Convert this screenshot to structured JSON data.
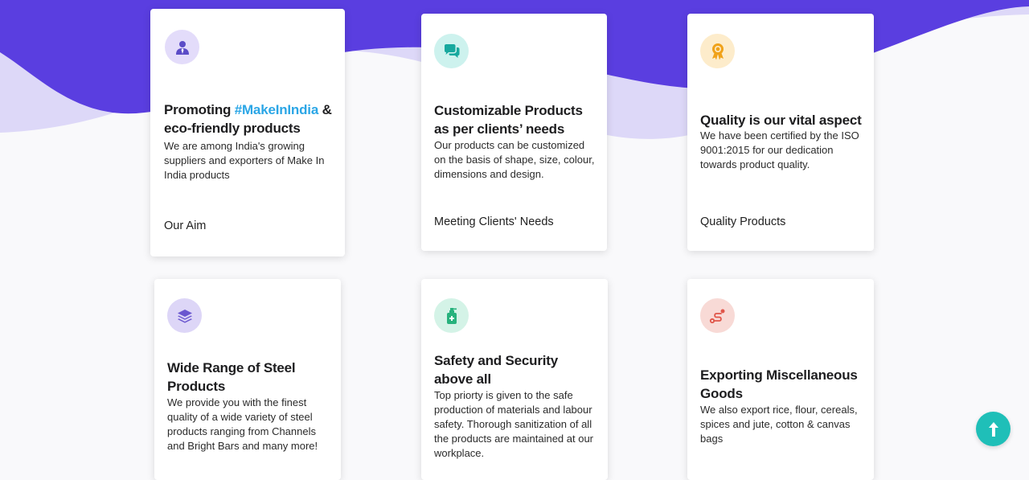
{
  "colors": {
    "wave_primary": "#5a3ee0",
    "wave_light": "#ddd8f8",
    "title_accent": "#2ba6e6",
    "scroll_button": "#1fbfb8"
  },
  "cards": [
    {
      "icon": "business-person-icon",
      "title_prefix": "Promoting ",
      "title_accent": "#MakeInIndia",
      "title_suffix": " & eco-friendly products",
      "description": "We are among India's growing suppliers and exporters of Make In India products",
      "footer": "Our Aim"
    },
    {
      "icon": "chat-bubbles-icon",
      "title": "Customizable Products as per clients’ needs",
      "description": "Our products can be customized on the basis of shape, size, colour, dimensions and design.",
      "footer": "Meeting Clients' Needs"
    },
    {
      "icon": "award-ribbon-icon",
      "title": "Quality is our vital aspect",
      "description": "We have been certified by the ISO 9001:2015 for our dedication towards product quality.",
      "footer": "Quality Products"
    },
    {
      "icon": "layers-icon",
      "title": "Wide Range of Steel Products",
      "description": "We provide you with the finest quality of a wide variety of steel products ranging from Channels and Bright Bars and many more!"
    },
    {
      "icon": "sanitizer-bottle-icon",
      "title": "Safety and Security above all",
      "description": "Top priorty is given to the safe production of materials and labour safety. Thorough sanitization of all the products are maintained at our workplace."
    },
    {
      "icon": "route-icon",
      "title": "Exporting Miscellaneous Goods",
      "description": "We also export rice, flour, cereals, spices and jute, cotton & canvas bags"
    }
  ],
  "back_to_top": {
    "icon": "arrow-up-icon"
  }
}
